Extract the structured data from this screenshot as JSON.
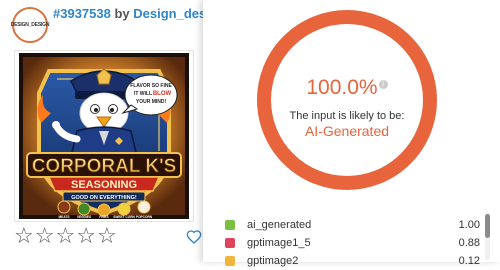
{
  "post": {
    "id_link": "#3937538",
    "by_text": "by",
    "author_link": "Design_design",
    "avatar_text": "DESIGN_DESIGN"
  },
  "artwork": {
    "speech_bubble": [
      "FLAVOR SO FINE",
      "IT WILL",
      "BLOW",
      "YOUR MIND!"
    ],
    "brand_title": "CORPORAL K'S",
    "brand_subtitle": "SEASONING",
    "tagline": "GOOD ON EVERYTHING!",
    "food_labels": [
      "MEATS",
      "VEGGIES",
      "FRIES",
      "SWEET CORN",
      "POPCORN"
    ]
  },
  "rating": {
    "stars": [
      "☆",
      "☆",
      "☆",
      "☆",
      "☆"
    ],
    "filled": 0
  },
  "detection": {
    "percent_text": "100.0%",
    "percent_value": 100.0,
    "info_glyph": "i",
    "likely_text": "The input is likely to be:",
    "verdict": "AI-Generated",
    "ring_color": "#e8643c",
    "results": [
      {
        "label": "ai_generated",
        "value": "1.00",
        "color": "#7ac143"
      },
      {
        "label": "gptimage1_5",
        "value": "0.88",
        "color": "#e0435a"
      },
      {
        "label": "gptimage2",
        "value": "0.12",
        "color": "#f0b63c"
      }
    ]
  },
  "icons": {
    "heart": "heart-icon",
    "info": "info-icon"
  }
}
